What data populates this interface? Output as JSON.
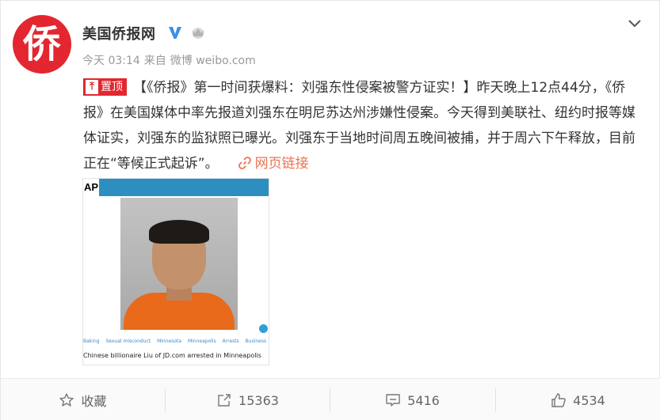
{
  "post": {
    "author": "美国侨报网",
    "avatar_text": "侨",
    "time": "今天 03:14",
    "source_prefix": "来自",
    "source": "微博 weibo.com",
    "pinned_label": "置顶",
    "text": "【《侨报》第一时间获爆料：刘强东性侵案被警方证实！】昨天晚上12点44分，《侨报》在美国媒体中率先报道刘强东在明尼苏达州涉嫌性侵案。今天得到美联社、纽约时报等媒体证实，刘强东的监狱照已曝光。刘强东于当地时间周五晚间被捕，并于周六下午释放，目前正在“等候正式起诉”。",
    "link_label": "网页链接"
  },
  "media": {
    "logo": "AP",
    "tags": [
      "Baking",
      "Sexual misconduct",
      "Minnesota",
      "Minneapolis",
      "Arrests",
      "Business"
    ],
    "caption": "Chinese billionaire Liu of JD.com arrested in Minneapolis"
  },
  "actions": {
    "favorite": "收藏",
    "repost": "15363",
    "comment": "5416",
    "like": "4534"
  },
  "colors": {
    "accent": "#e3262f",
    "link": "#eb7350",
    "verify": "#3c8fe6"
  }
}
